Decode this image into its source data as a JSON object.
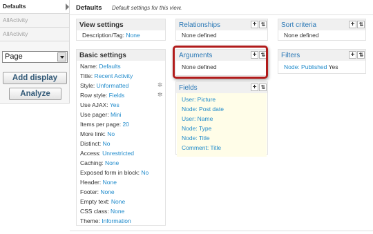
{
  "displays": {
    "items": [
      {
        "label": "Defaults"
      },
      {
        "label": "AllActivity"
      },
      {
        "label": "AllActivity"
      }
    ],
    "select_value": "Page",
    "add_display_label": "Add display",
    "analyze_label": "Analyze"
  },
  "header": {
    "title": "Defaults",
    "description": "Default settings for this view."
  },
  "view_settings": {
    "title": "View settings",
    "description_label": "Description/Tag:",
    "description_value": "None"
  },
  "basic_settings": {
    "title": "Basic settings",
    "rows": [
      {
        "label": "Name:",
        "value": "Defaults"
      },
      {
        "label": "Title:",
        "value": "Recent Activity"
      },
      {
        "label": "Style:",
        "value": "Unformatted"
      },
      {
        "label": "Row style:",
        "value": "Fields"
      },
      {
        "label": "Use AJAX:",
        "value": "Yes"
      },
      {
        "label": "Use pager:",
        "value": "Mini"
      },
      {
        "label": "Items per page:",
        "value": "20"
      },
      {
        "label": "More link:",
        "value": "No"
      },
      {
        "label": "Distinct:",
        "value": "No"
      },
      {
        "label": "Access:",
        "value": "Unrestricted"
      },
      {
        "label": "Caching:",
        "value": "None"
      },
      {
        "label": "Exposed form in block:",
        "value": "No"
      },
      {
        "label": "Header:",
        "value": "None"
      },
      {
        "label": "Footer:",
        "value": "None"
      },
      {
        "label": "Empty text:",
        "value": "None"
      },
      {
        "label": "CSS class:",
        "value": "None"
      },
      {
        "label": "Theme:",
        "value": "Information"
      }
    ]
  },
  "relationships": {
    "title": "Relationships",
    "empty": "None defined"
  },
  "arguments": {
    "title": "Arguments",
    "empty": "None defined"
  },
  "fields": {
    "title": "Fields",
    "items": [
      "User: Picture",
      "Node: Post date",
      "User: Name",
      "Node: Type",
      "Node: Title",
      "Comment: Title"
    ]
  },
  "sort_criteria": {
    "title": "Sort criteria",
    "empty": "None defined"
  },
  "filters": {
    "title": "Filters",
    "filter_value": "Node: Published",
    "filter_suffix": "Yes"
  },
  "controls": {
    "add": "+",
    "rearrange": "⇅"
  },
  "colors": {
    "link": "#1e8acb",
    "highlight": "#b11b1b"
  }
}
